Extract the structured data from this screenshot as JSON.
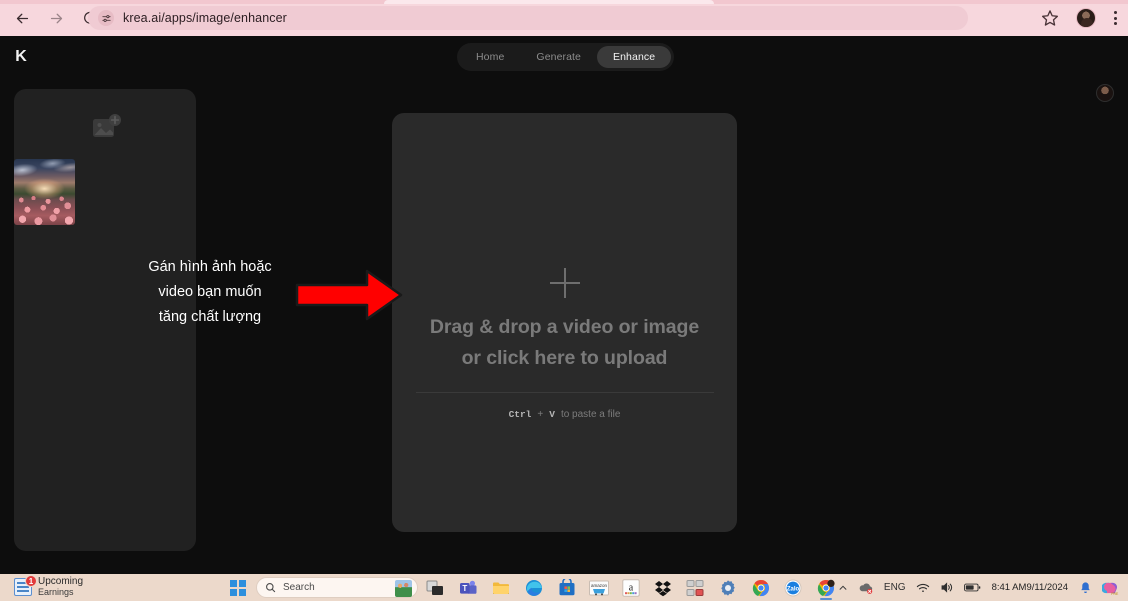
{
  "browser": {
    "url": "krea.ai/apps/image/enhancer",
    "back_icon": "back-arrow-icon",
    "forward_icon": "forward-arrow-icon",
    "reload_icon": "reload-icon",
    "site_settings_icon": "site-settings-icon",
    "bookmark_icon": "star-icon",
    "profile_icon": "profile-avatar-icon",
    "menu_icon": "three-dot-menu-icon",
    "chrome_theme_color": "#f7d7dd"
  },
  "app": {
    "logo_text": "K",
    "tabs": [
      {
        "label": "Home",
        "active": false
      },
      {
        "label": "Generate",
        "active": false
      },
      {
        "label": "Enhance",
        "active": true
      }
    ],
    "account_avatar": "user-avatar-icon",
    "accent_panel_color": "#2a2a2a"
  },
  "left_panel": {
    "add_image_icon": "add-image-icon",
    "thumbnail_alt": "sunset-over-rose-field-thumbnail"
  },
  "drop_zone": {
    "plus_icon": "plus-icon",
    "title_line1": "Drag & drop a video or image",
    "title_line2": "or click here to upload",
    "paste_hint": {
      "key1": "Ctrl",
      "plus": "+",
      "key2": "V",
      "text": "to paste a file"
    }
  },
  "annotation": {
    "line1": "Gán hình ảnh hoặc",
    "line2": "video bạn muốn",
    "line3": "tăng chất lượng",
    "arrow_icon": "red-right-arrow-icon",
    "arrow_color": "#ff0000"
  },
  "taskbar": {
    "widget": {
      "badge": "1",
      "title": "Upcoming",
      "subtitle": "Earnings",
      "icon": "news-widget-icon"
    },
    "start_icon": "windows-start-icon",
    "search": {
      "placeholder": "Search",
      "icon": "search-icon"
    },
    "pinned": [
      {
        "name": "task-view-icon"
      },
      {
        "name": "microsoft-teams-icon"
      },
      {
        "name": "file-explorer-icon"
      },
      {
        "name": "microsoft-edge-icon"
      },
      {
        "name": "microsoft-store-icon"
      },
      {
        "name": "amazon-shopping-icon"
      },
      {
        "name": "amazon-icon"
      },
      {
        "name": "dropbox-icon"
      },
      {
        "name": "keyboard-app-icon"
      },
      {
        "name": "settings-gear-icon"
      },
      {
        "name": "google-chrome-icon"
      },
      {
        "name": "zalo-icon"
      },
      {
        "name": "google-chrome-active-icon"
      }
    ],
    "tray": {
      "overflow_icon": "chevron-up-icon",
      "onedrive_icon": "onedrive-alert-icon",
      "language": "ENG",
      "wifi_icon": "wifi-icon",
      "volume_icon": "speaker-icon",
      "battery_icon": "battery-icon",
      "time": "8:41 AM",
      "date": "9/11/2024",
      "notification_icon": "bell-icon",
      "copilot_icon": "copilot-icon"
    }
  }
}
